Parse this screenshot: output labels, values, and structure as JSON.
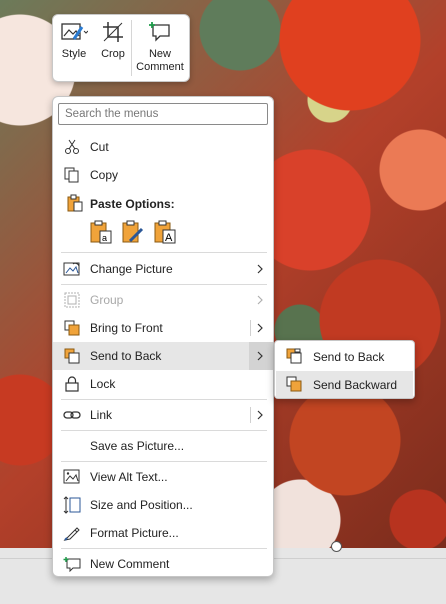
{
  "mini_toolbar": {
    "style_label": "Style",
    "crop_label": "Crop",
    "new_comment_label_line1": "New",
    "new_comment_label_line2": "Comment"
  },
  "context_menu": {
    "search_placeholder": "Search the menus",
    "items": {
      "cut": "Cut",
      "copy": "Copy",
      "paste_options": "Paste Options:",
      "change_picture": "Change Picture",
      "group": "Group",
      "bring_to_front": "Bring to Front",
      "send_to_back": "Send to Back",
      "lock": "Lock",
      "link": "Link",
      "save_as_picture": "Save as Picture...",
      "view_alt_text": "View Alt Text...",
      "size_and_position": "Size and Position...",
      "format_picture": "Format Picture...",
      "new_comment": "New Comment"
    }
  },
  "submenu": {
    "send_to_back": "Send to Back",
    "send_backward": "Send Backward"
  },
  "colors": {
    "accent_orange": "#f0a33a",
    "icon_blue": "#2b5797",
    "highlight": "#e6e6e6"
  }
}
